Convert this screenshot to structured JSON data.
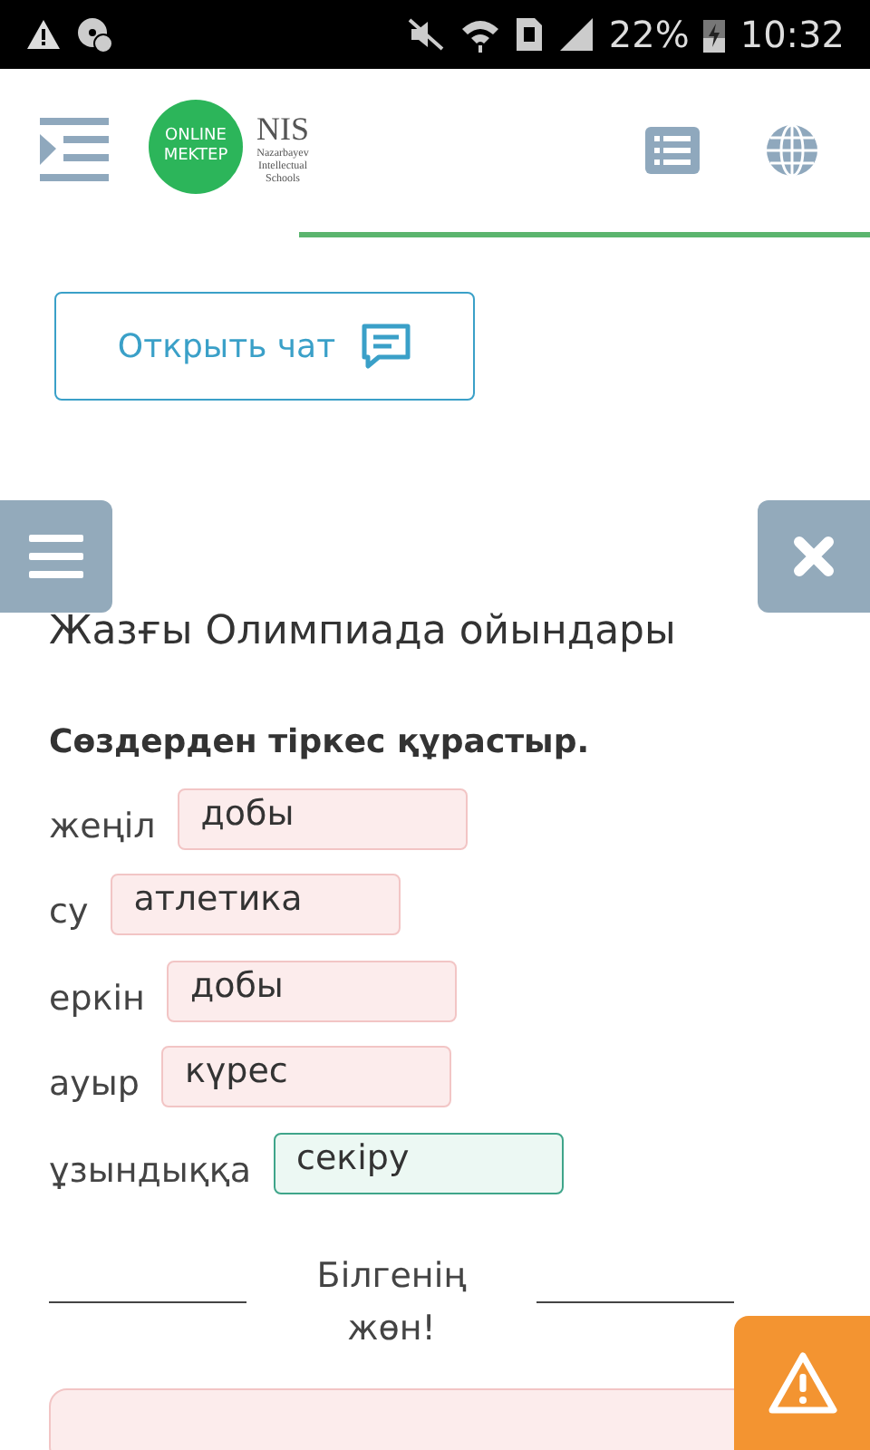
{
  "status_bar": {
    "battery": "22%",
    "time": "10:32"
  },
  "header": {
    "logo_text": "ONLINE MEKTEP",
    "partner_logo": {
      "name": "NIS",
      "subtitle": "Nazarbayev Intellectual Schools"
    }
  },
  "chat_button": {
    "label": "Открыть чат"
  },
  "title": "Жазғы Олимпиада ойындары",
  "task": {
    "instruction": "Сөздерден тіркес құрастыр.",
    "rows": [
      {
        "word": "жеңіл",
        "answer": "добы",
        "correct": false
      },
      {
        "word": "су",
        "answer": "атлетика",
        "correct": false
      },
      {
        "word": "еркін",
        "answer": "добы",
        "correct": false
      },
      {
        "word": "ауыр",
        "answer": "күрес",
        "correct": false
      },
      {
        "word": "ұзындыққа",
        "answer": "секіру",
        "correct": true
      }
    ]
  },
  "feedback": "Білгенің жөн!"
}
